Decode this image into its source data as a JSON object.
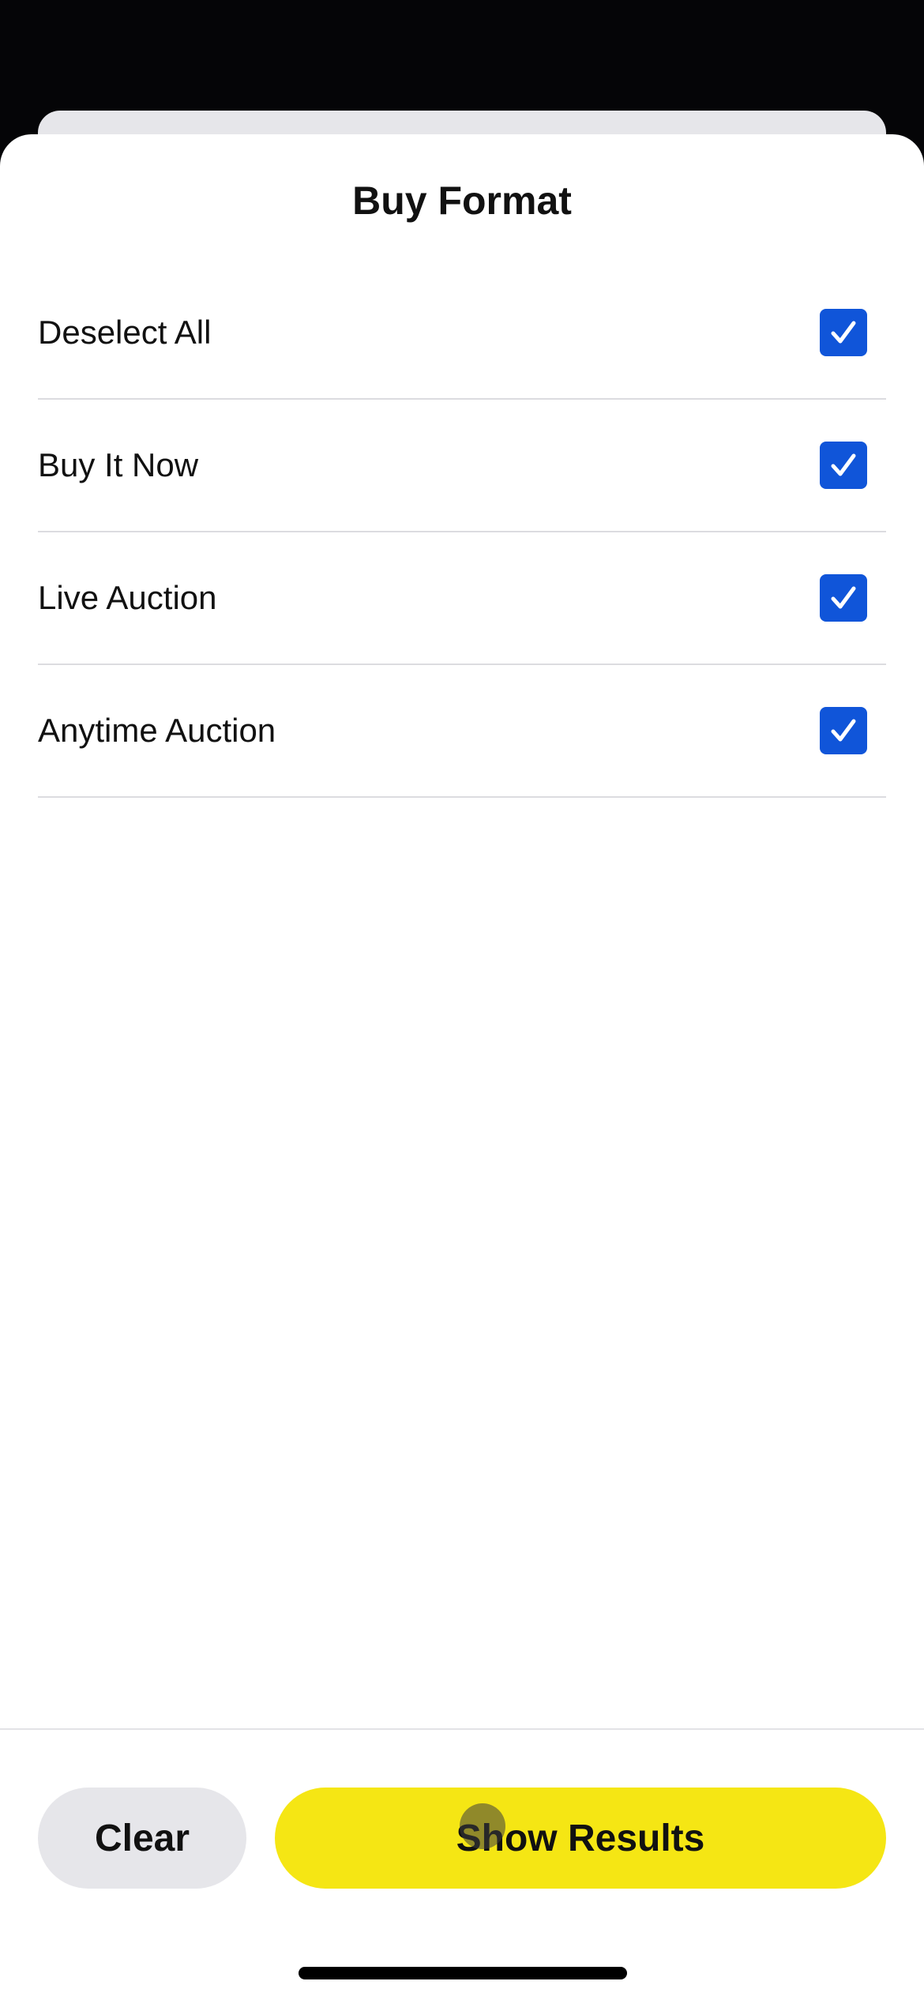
{
  "sheet": {
    "title": "Buy Format"
  },
  "options": [
    {
      "label": "Deselect All",
      "checked": true
    },
    {
      "label": "Buy It Now",
      "checked": true
    },
    {
      "label": "Live Auction",
      "checked": true
    },
    {
      "label": "Anytime Auction",
      "checked": true
    }
  ],
  "footer": {
    "clear_label": "Clear",
    "show_results_label": "Show Results"
  },
  "colors": {
    "checkbox_fill": "#1055d9",
    "primary_button": "#f5e614",
    "secondary_button": "#e6e6ea"
  },
  "icons": {
    "checkbox": "checkmark-icon"
  }
}
